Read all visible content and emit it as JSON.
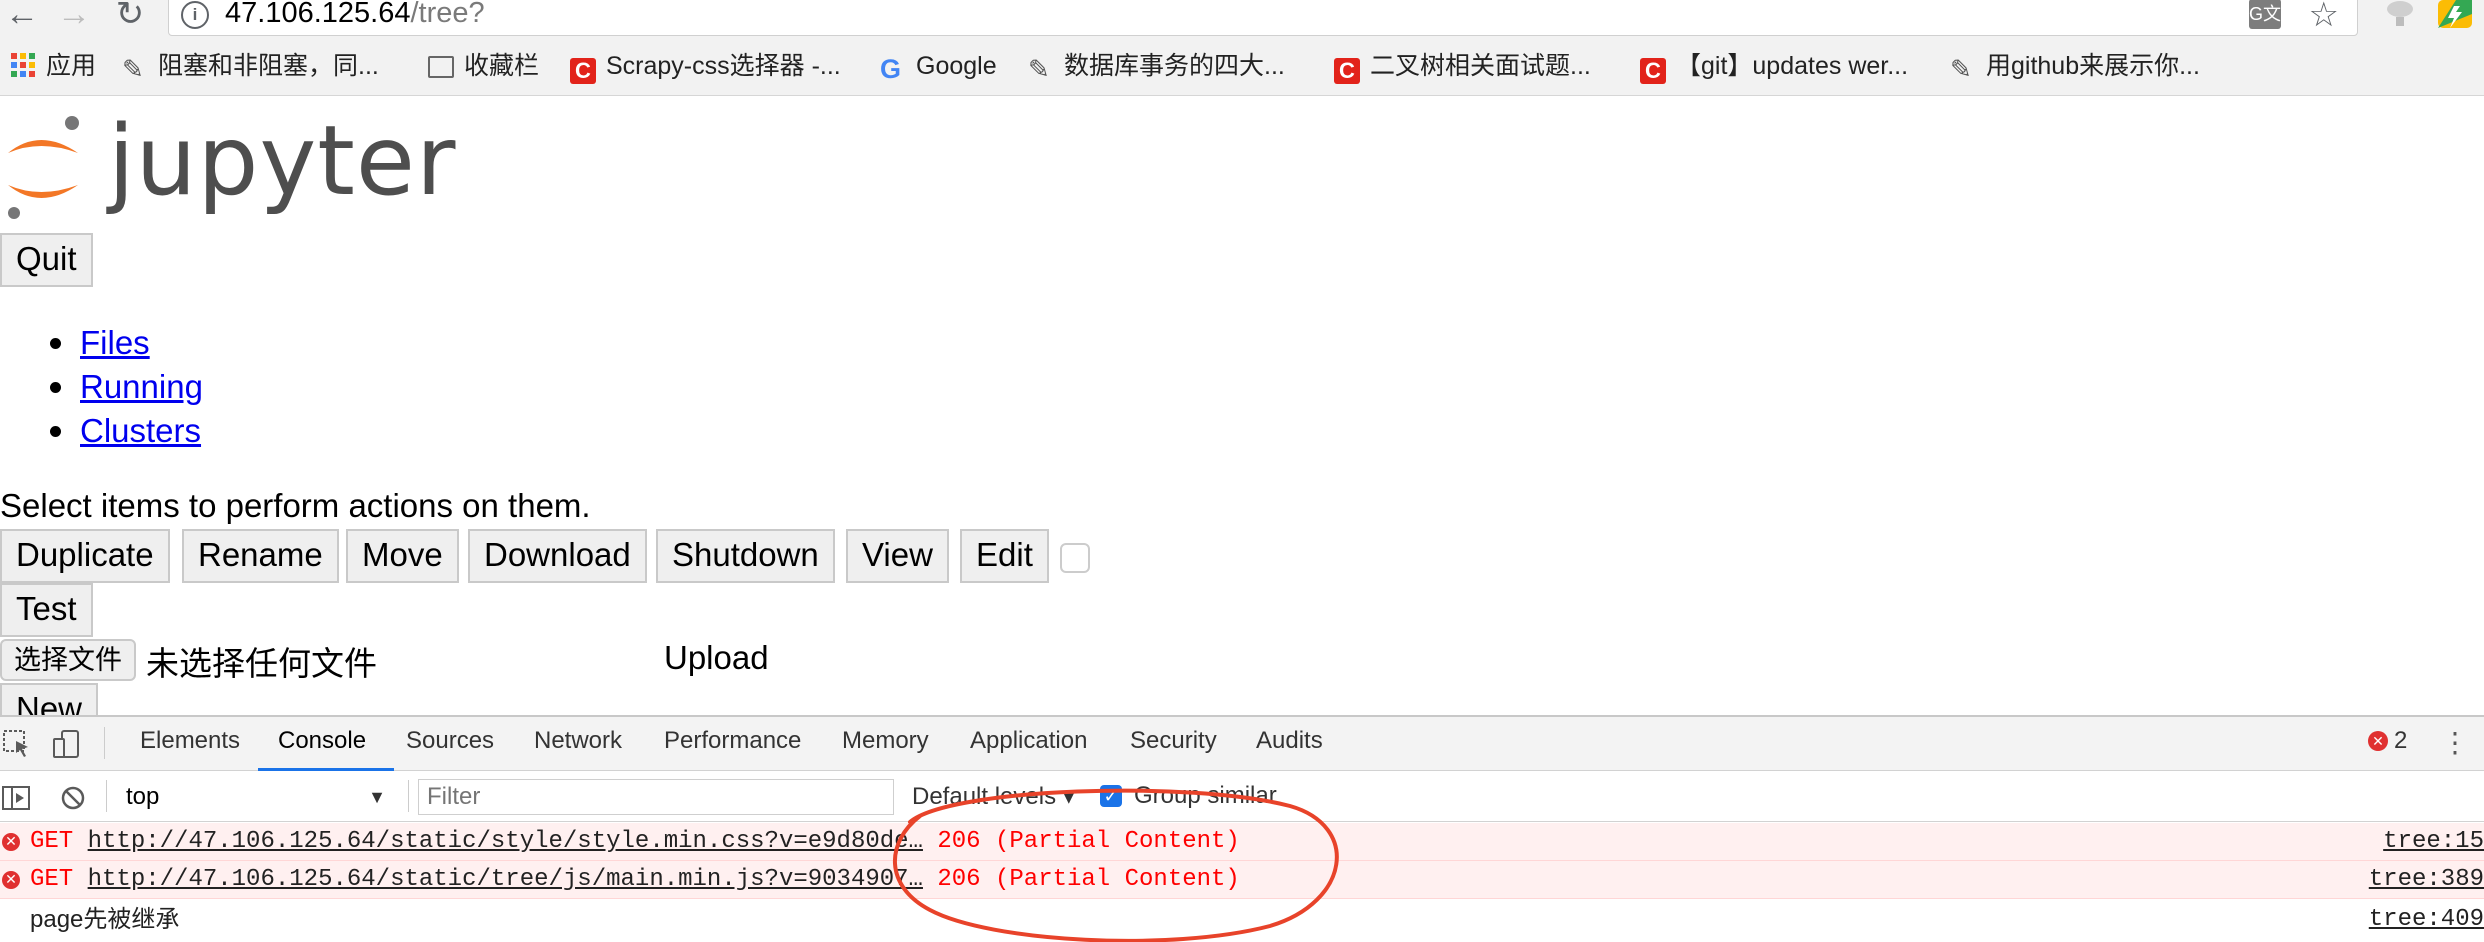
{
  "browser": {
    "url_host": "47.106.125.64",
    "url_path": "/tree?",
    "nav": {
      "back": "←",
      "forward": "→",
      "reload": "↻"
    },
    "info_icon": "i",
    "translate_icon": "G文",
    "star_icon": "☆"
  },
  "bookmarks": [
    {
      "label": "应用",
      "icon": "apps-grid-icon"
    },
    {
      "label": "阻塞和非阻塞，同...",
      "icon": "pen-icon"
    },
    {
      "label": "收藏栏",
      "icon": "folder-icon"
    },
    {
      "label": "Scrapy-css选择器 -...",
      "icon": "csdn-icon"
    },
    {
      "label": "Google",
      "icon": "google-icon"
    },
    {
      "label": "数据库事务的四大...",
      "icon": "pen-icon"
    },
    {
      "label": "二叉树相关面试题...",
      "icon": "csdn-icon"
    },
    {
      "label": "【git】updates wer...",
      "icon": "csdn-icon"
    },
    {
      "label": "用github来展示你...",
      "icon": "pen-icon"
    }
  ],
  "jupyter": {
    "logo_text": "jupyter",
    "quit_label": "Quit",
    "nav_links": [
      "Files",
      "Running",
      "Clusters"
    ],
    "select_hint": "Select items to perform actions on them.",
    "actions": [
      "Duplicate",
      "Rename",
      "Move",
      "Download",
      "Shutdown",
      "View",
      "Edit"
    ],
    "test_label": "Test",
    "file_button": "选择文件",
    "file_status": "未选择任何文件",
    "upload_label": "Upload",
    "new_label": "New"
  },
  "devtools": {
    "tabs": [
      "Elements",
      "Console",
      "Sources",
      "Network",
      "Performance",
      "Memory",
      "Application",
      "Security",
      "Audits"
    ],
    "active_tab": "Console",
    "error_count": "2",
    "context": "top",
    "filter_placeholder": "Filter",
    "levels_label": "Default levels ▾",
    "group_similar_label": "Group similar",
    "logs": [
      {
        "type": "error",
        "method": "GET",
        "url": "http://47.106.125.64/static/style/style.min.css?v=e9d80de…",
        "status": "206 (Partial Content)",
        "source": "tree:15"
      },
      {
        "type": "error",
        "method": "GET",
        "url": "http://47.106.125.64/static/tree/js/main.min.js?v=9034907…",
        "status": "206 (Partial Content)",
        "source": "tree:389"
      },
      {
        "type": "info",
        "text": "page先被继承",
        "source": "tree:409"
      }
    ]
  },
  "colors": {
    "annotation": "#e8432a",
    "jupyter_orange": "#f37726",
    "link": "#0000ee",
    "error_text": "#ff0000",
    "devtools_accent": "#1a73e8"
  }
}
